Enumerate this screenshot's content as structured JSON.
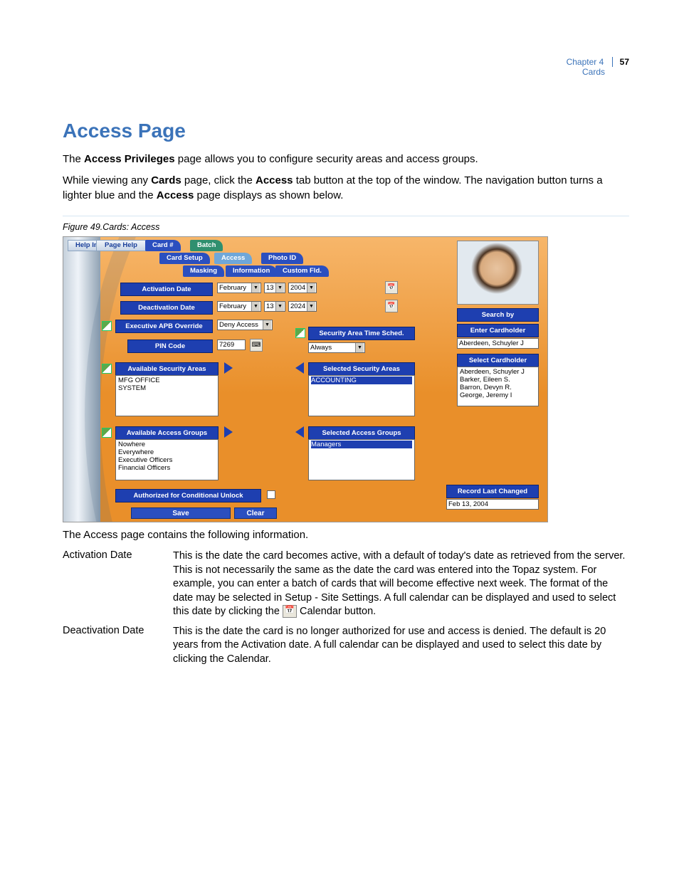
{
  "header": {
    "chapter": "Chapter 4",
    "section": "Cards",
    "page_number": "57"
  },
  "title": "Access Page",
  "intro": {
    "p1_pre": "The ",
    "p1_b1": "Access Privileges",
    "p1_post": " page allows you to configure security areas and access groups.",
    "p2_a": "While viewing any ",
    "p2_b1": "Cards",
    "p2_c": " page, click the ",
    "p2_b2": "Access",
    "p2_d": " tab button at the top of the window. The navigation button turns a lighter blue and the ",
    "p2_b3": "Access",
    "p2_e": " page displays as shown below."
  },
  "figure_caption": "Figure 49.Cards: Access",
  "ui": {
    "help_index": "Help Index",
    "page_help": "Page Help",
    "tabs": {
      "card_no": "Card #",
      "batch": "Batch",
      "card_setup": "Card Setup",
      "access": "Access",
      "photo_id": "Photo ID",
      "masking": "Masking",
      "information": "Information",
      "custom": "Custom Fld."
    },
    "labels": {
      "activation": "Activation Date",
      "deactivation": "Deactivation Date",
      "apb": "Executive  APB Override",
      "pin": "PIN Code",
      "avail_areas": "Available Security Areas",
      "sel_areas": "Selected Security Areas",
      "area_sched": "Security Area Time Sched.",
      "avail_groups": "Available Access Groups",
      "sel_groups": "Selected Access Groups",
      "cond_unlock": "Authorized for Conditional Unlock",
      "search_by": "Search by",
      "enter_ch": "Enter Cardholder",
      "select_ch": "Select Cardholder",
      "rec_changed": "Record Last Changed"
    },
    "values": {
      "act_month": "February",
      "act_day": "13",
      "act_year": "2004",
      "deact_month": "February",
      "deact_day": "13",
      "deact_year": "2024",
      "apb_sel": "Deny Access",
      "pin": "7269",
      "sched_sel": "Always",
      "avail_areas": [
        "MFG OFFICE",
        "SYSTEM"
      ],
      "sel_areas": [
        "ACCOUNTING"
      ],
      "avail_groups": [
        "Nowhere",
        "Everywhere",
        "Executive Officers",
        "Financial Officers"
      ],
      "sel_groups": [
        "Managers"
      ],
      "enter_ch": "Aberdeen, Schuyler J",
      "cardholders": [
        "Aberdeen, Schuyler J",
        "Barker, Eileen S.",
        "Barron, Devyn R.",
        "George, Jeremy I"
      ],
      "rec_changed": "Feb 13, 2004"
    },
    "buttons": {
      "save": "Save",
      "clear": "Clear"
    }
  },
  "after_fig": "The Access page contains the following information.",
  "defs": {
    "activation": {
      "term": "Activation Date",
      "desc_a": "This is the date the card becomes active, with a default of today's date as retrieved from the server. This is not necessarily the same as the date the card was entered into the Topaz system. For example, you can enter a batch of cards that will become effective next week. The format of the date may be selected in Setup - Site Settings. A full calendar can be displayed and used to select this date by clicking the ",
      "desc_b": " Calendar button."
    },
    "deactivation": {
      "term": "Deactivation Date",
      "desc": "This is the date the card is no longer authorized for use and access is denied. The default is 20 years from the Activation date. A full calendar can be displayed and used to select this date by clicking the Calendar."
    }
  }
}
